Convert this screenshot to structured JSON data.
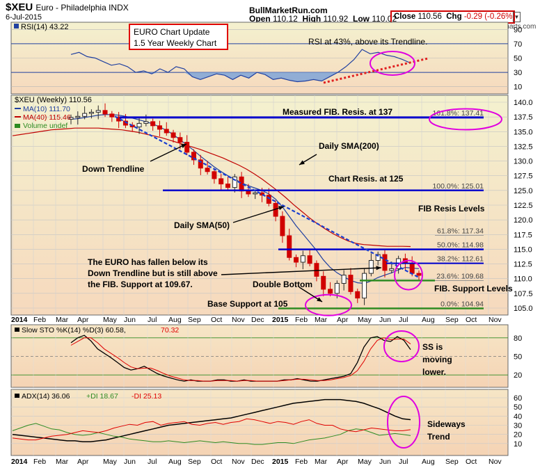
{
  "header": {
    "symbol": "$XEU",
    "name": "Euro - Philadelphia INDX",
    "date": "6-Jul-2015",
    "source": "BullMarketRun.com",
    "open_label": "Open",
    "open": "110.12",
    "high_label": "High",
    "high": "110.92",
    "low_label": "Low",
    "low": "110.02",
    "close_label": "Close",
    "close": "110.56",
    "chg_label": "Chg",
    "chg": "-0.29 (-0.26%)",
    "credit": "@StockCharts.com"
  },
  "colors": {
    "up": "#2a2a2a",
    "down": "#d00000",
    "ma10": "#1f3fa0",
    "ma40": "#c00000",
    "annotation_line": "#0000cc",
    "support_line": "#2e8b22",
    "highlight": "#e000e0",
    "panel_bg_top": "#f4f1cf",
    "panel_bg_bottom": "#f6d9bd"
  },
  "chart_data": [
    {
      "type": "line",
      "panel": "rsi",
      "legend": "RSI(14) 43.22",
      "ylim": [
        0,
        100
      ],
      "y_ticks": [
        10,
        30,
        50,
        70,
        90
      ],
      "overbought": 70,
      "oversold": 30,
      "series": [
        {
          "name": "RSI(14)",
          "values": [
            55,
            58,
            52,
            50,
            45,
            40,
            42,
            38,
            30,
            32,
            28,
            35,
            30,
            38,
            35,
            24,
            20,
            24,
            28,
            26,
            20,
            26,
            22,
            30,
            27,
            20,
            22,
            19,
            17,
            18,
            20,
            18,
            24,
            30,
            38,
            48,
            62,
            56,
            58,
            54,
            52,
            48,
            43
          ]
        }
      ],
      "annotations": [
        "EURO Chart Update",
        "1.5 Year Weekly Chart",
        "RSI at 43%, above its Trendline."
      ]
    },
    {
      "type": "candlestick",
      "panel": "price",
      "legend": [
        "$XEU (Weekly) 110.56",
        "MA(10) 111.70",
        "MA(40) 115.46",
        "Volume undef"
      ],
      "ylim": [
        105,
        140
      ],
      "y_ticks": [
        105,
        107.5,
        110,
        112.5,
        115,
        117.5,
        120,
        122.5,
        125,
        127.5,
        130,
        132.5,
        135,
        137.5,
        140
      ],
      "x_labels": [
        "2014",
        "Feb",
        "Mar",
        "Apr",
        "May",
        "Jun",
        "Jul",
        "Aug",
        "Sep",
        "Oct",
        "Nov",
        "Dec",
        "2015",
        "Feb",
        "Mar",
        "Apr",
        "May",
        "Jun",
        "Jul",
        "Aug",
        "Sep",
        "Oct",
        "Nov"
      ],
      "close": [
        137.4,
        137.6,
        138.1,
        138.3,
        138.6,
        138.0,
        137.5,
        136.8,
        136.1,
        135.8,
        136.4,
        136.7,
        136.0,
        135.4,
        134.8,
        134.0,
        133.2,
        131.5,
        130.2,
        128.8,
        128.2,
        127.0,
        126.1,
        125.5,
        127.3,
        124.9,
        124.4,
        124.6,
        124.2,
        122.8,
        120.6,
        117.3,
        113.6,
        112.8,
        113.9,
        112.6,
        110.4,
        108.2,
        107.5,
        109.2,
        110.6,
        107.8,
        106.7,
        110.9,
        113.1,
        114.1,
        111.4,
        111.7,
        113.4,
        112.6,
        110.9,
        110.56
      ],
      "ma10": [
        137.1,
        137.2,
        137.4,
        137.6,
        137.8,
        137.9,
        137.9,
        137.8,
        137.6,
        137.3,
        137.0,
        136.7,
        136.3,
        135.8,
        135.2,
        134.5,
        133.6,
        132.7,
        131.8,
        130.8,
        129.9,
        129.0,
        128.2,
        127.5,
        126.9,
        126.3,
        125.8,
        125.4,
        125.0,
        124.4,
        123.5,
        122.2,
        120.6,
        119.0,
        117.6,
        116.2,
        114.8,
        113.2,
        111.9,
        111.0,
        110.3,
        109.7,
        109.3,
        109.2,
        109.6,
        110.2,
        110.6,
        111.0,
        111.5,
        111.9,
        111.8,
        111.7
      ],
      "ma40": [
        134.3,
        134.5,
        134.7,
        134.9,
        135.1,
        135.3,
        135.4,
        135.5,
        135.6,
        135.6,
        135.6,
        135.6,
        135.5,
        135.4,
        135.3,
        135.1,
        134.9,
        134.6,
        134.3,
        134.0,
        133.6,
        133.2,
        132.8,
        132.4,
        132.0,
        131.5,
        131.0,
        130.5,
        129.9,
        129.3,
        128.6,
        127.8,
        126.9,
        125.9,
        124.9,
        123.8,
        122.6,
        121.5,
        120.4,
        119.4,
        118.5,
        117.7,
        117.0,
        116.4,
        116.0,
        115.8,
        115.7,
        115.6,
        115.5,
        115.5,
        115.5,
        115.46
      ],
      "fib_levels": [
        {
          "label": "161.8%: 137.41",
          "value": 137.41
        },
        {
          "label": "100.0%: 125.01",
          "value": 125.01
        },
        {
          "label": "61.8%: 117.34",
          "value": 117.34
        },
        {
          "label": "50.0%: 114.98",
          "value": 114.98
        },
        {
          "label": "38.2%: 112.61",
          "value": 112.61
        },
        {
          "label": "23.6%: 109.68",
          "value": 109.68
        },
        {
          "label": "0.0%: 104.94",
          "value": 104.94
        }
      ],
      "annotations": [
        "Measured FIB. Resis. at 137",
        "Daily SMA(200)",
        "Down Trendline",
        "Chart Resis. at 125",
        "FIB Resis Levels",
        "Daily SMA(50)",
        "The EURO has fallen below its",
        "Down Trendline but is still above",
        "the FIB. Support at 109.67.",
        "Double Bottom",
        "FIB. Support Levels",
        "Base Support at 105"
      ]
    },
    {
      "type": "line",
      "panel": "stochastics",
      "legend": [
        "Slow STO %K(14) %D(3) 60.58,",
        "70.32"
      ],
      "ylim": [
        0,
        100
      ],
      "y_ticks": [
        20,
        50,
        80
      ],
      "series": [
        {
          "name": "%K(14)",
          "values": [
            72,
            80,
            84,
            75,
            62,
            55,
            48,
            40,
            32,
            28,
            30,
            34,
            28,
            22,
            18,
            15,
            12,
            10,
            12,
            10,
            10,
            10,
            12,
            12,
            10,
            10,
            12,
            10,
            10,
            10,
            10,
            10,
            12,
            12,
            14,
            12,
            10,
            10,
            12,
            14,
            16,
            18,
            22,
            40,
            65,
            80,
            82,
            76,
            74,
            82,
            76,
            61
          ]
        },
        {
          "name": "%D(3)",
          "values": [
            68,
            74,
            80,
            80,
            72,
            62,
            55,
            48,
            40,
            33,
            30,
            31,
            31,
            27,
            22,
            18,
            15,
            12,
            11,
            11,
            10,
            10,
            11,
            11,
            11,
            10,
            11,
            11,
            10,
            10,
            10,
            10,
            11,
            12,
            13,
            13,
            12,
            11,
            11,
            12,
            14,
            16,
            19,
            27,
            42,
            62,
            76,
            80,
            77,
            78,
            78,
            70
          ]
        }
      ],
      "annotations": [
        "SS is",
        "moving",
        "lower."
      ]
    },
    {
      "type": "line",
      "panel": "adx",
      "legend": [
        "ADX(14) 36.06",
        "+DI 18.67",
        "-DI 25.13"
      ],
      "ylim": [
        0,
        60
      ],
      "y_ticks": [
        10,
        20,
        30,
        40,
        50,
        60
      ],
      "series": [
        {
          "name": "ADX(14)",
          "values": [
            20,
            19,
            18,
            17,
            16,
            15,
            14,
            13,
            13,
            12,
            12,
            13,
            14,
            16,
            18,
            20,
            22,
            24,
            26,
            28,
            30,
            31,
            32,
            33,
            34,
            35,
            36,
            37,
            38,
            40,
            42,
            44,
            46,
            48,
            50,
            52,
            54,
            55,
            56,
            57,
            58,
            58,
            58,
            57,
            56,
            54,
            51,
            48,
            44,
            40,
            37,
            36.06
          ]
        },
        {
          "name": "+DI",
          "values": [
            24,
            27,
            30,
            32,
            29,
            26,
            25,
            22,
            20,
            19,
            20,
            22,
            20,
            18,
            17,
            15,
            14,
            13,
            12,
            12,
            13,
            12,
            11,
            12,
            13,
            12,
            11,
            12,
            11,
            10,
            10,
            9,
            9,
            10,
            11,
            11,
            10,
            12,
            14,
            15,
            16,
            18,
            20,
            24,
            26,
            25,
            22,
            19,
            20,
            21,
            20,
            18.67
          ]
        },
        {
          "name": "-DI",
          "values": [
            16,
            15,
            14,
            14,
            16,
            18,
            19,
            20,
            22,
            24,
            23,
            22,
            24,
            27,
            29,
            31,
            30,
            33,
            34,
            30,
            32,
            33,
            34,
            31,
            30,
            32,
            33,
            31,
            33,
            34,
            37,
            36,
            34,
            32,
            34,
            33,
            31,
            34,
            36,
            32,
            30,
            30,
            26,
            24,
            23,
            25,
            27,
            26,
            25,
            24,
            24,
            25.13
          ]
        }
      ],
      "annotations": [
        "Sideways",
        "Trend"
      ]
    }
  ]
}
